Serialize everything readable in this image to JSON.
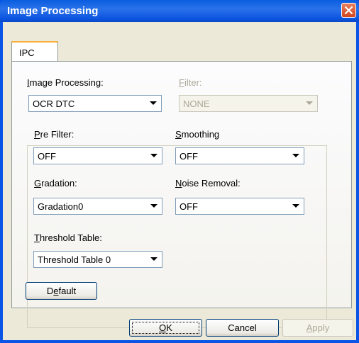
{
  "window": {
    "title": "Image Processing"
  },
  "tabs": [
    {
      "label": "IPC"
    }
  ],
  "image_processing": {
    "label": "Image Processing:",
    "value": "OCR DTC"
  },
  "filter": {
    "label": "Filter:",
    "value": "NONE"
  },
  "pre_filter": {
    "label": "Pre Filter:",
    "value": "OFF"
  },
  "smoothing": {
    "label": "Smoothing",
    "value": "OFF"
  },
  "gradation": {
    "label": "Gradation:",
    "value": "Gradation0"
  },
  "noise_removal": {
    "label": "Noise Removal:",
    "value": "OFF"
  },
  "threshold_table": {
    "label": "Threshold Table:",
    "value": "Threshold Table 0"
  },
  "buttons": {
    "default": "Default",
    "ok": "OK",
    "cancel": "Cancel",
    "apply": "Apply"
  },
  "colors": {
    "titlebar": "#0a5ddf",
    "client": "#ece9d8",
    "close": "#d2461e"
  },
  "icons": {
    "close": "close-icon",
    "dropdown": "chevron-down-icon"
  }
}
